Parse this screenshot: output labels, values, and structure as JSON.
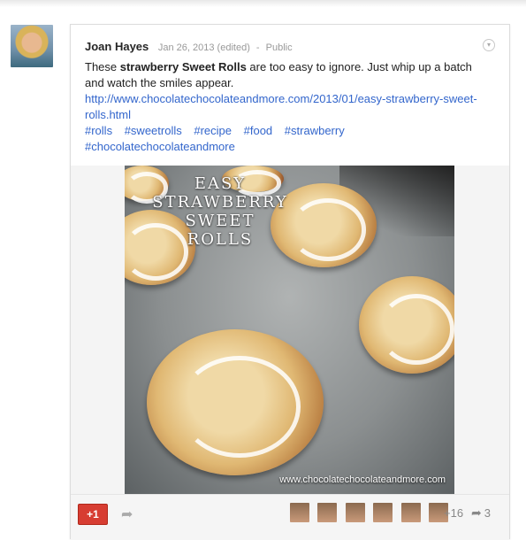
{
  "post": {
    "author": "Joan Hayes",
    "date": "Jan 26, 2013 (edited)",
    "separator": "-",
    "visibility": "Public",
    "text_before": "These ",
    "text_bold": "strawberry Sweet Rolls",
    "text_after": " are too easy to ignore. Just whip up a batch and watch the smiles appear. ",
    "link": "http://www.chocolatechocolateandmore.com/2013/01/easy-strawberry-sweet-rolls.html",
    "tags": [
      "#rolls",
      "#sweetrolls",
      "#recipe",
      "#food",
      "#strawberry",
      "#chocolatechocolateandmore"
    ]
  },
  "photo": {
    "title_line1": "Easy",
    "title_line2": "Strawberry",
    "title_line3": "Sweet",
    "title_line4": "Rolls",
    "credit": "www.chocolatechocolateandmore.com"
  },
  "footer": {
    "plus_one_label": "+1",
    "plus_count": "+16",
    "share_count": "3"
  },
  "icons": {
    "menu": "chevron-down-icon",
    "share": "share-arrow-icon"
  },
  "colors": {
    "link": "#3366cc",
    "plus_one": "#d73d32"
  }
}
